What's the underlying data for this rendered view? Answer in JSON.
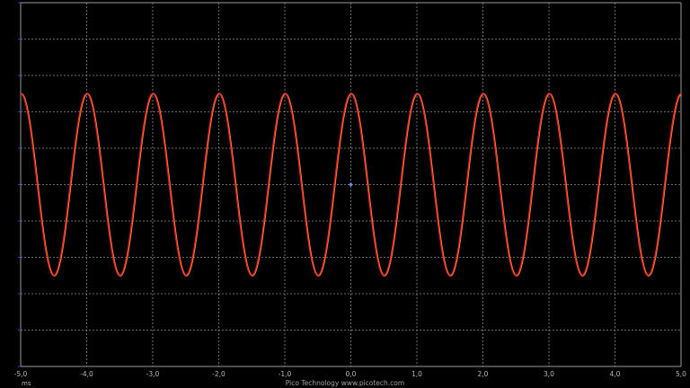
{
  "chart_data": {
    "type": "line",
    "title": "",
    "xlabel": "ms",
    "ylabel": "",
    "xlim": [
      -5.0,
      5.0
    ],
    "ylim": [
      -5.0,
      5.0
    ],
    "x_ticks": [
      "-5,0",
      "-4,0",
      "-3,0",
      "-2,0",
      "-1,0",
      "0,0",
      "1,0",
      "2,0",
      "3,0",
      "4,0",
      "5,0"
    ],
    "y_ticks": [],
    "grid": true,
    "background": "#000000",
    "series": [
      {
        "amplitude": 2.5,
        "frequency_khz": 1.0,
        "phase_deg": 90,
        "color": "#ff8c00"
      },
      {
        "amplitude": 2.5,
        "frequency_khz": 1.0,
        "phase_deg": 90,
        "color": "#e0204a"
      }
    ],
    "trigger_marker": {
      "x": 0.0,
      "y": 0.0,
      "color": "#5f8dff"
    }
  },
  "footer": {
    "brand": "Pico Technology   www.picotech.com"
  }
}
